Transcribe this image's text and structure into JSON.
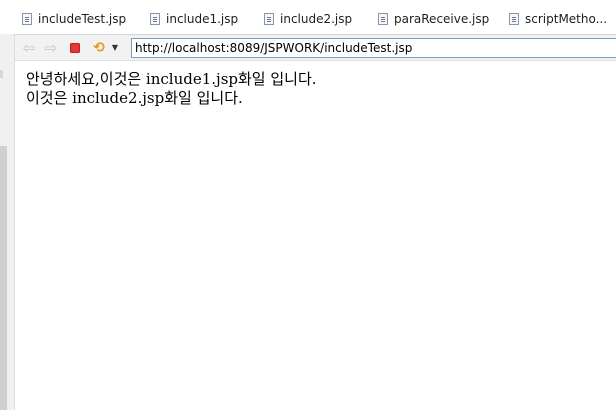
{
  "tabs": [
    {
      "label": "includeTest.jsp"
    },
    {
      "label": "include1.jsp"
    },
    {
      "label": "include2.jsp"
    },
    {
      "label": "paraReceive.jsp"
    },
    {
      "label": "scriptMetho..."
    }
  ],
  "toolbar": {
    "back_icon": "back-arrow-icon",
    "forward_icon": "forward-arrow-icon",
    "stop_icon": "stop-icon",
    "stop_color": "#e23a3a",
    "refresh_icon": "refresh-icon",
    "refresh_color": "#e39a1c",
    "url": "http://localhost:8089/JSPWORK/includeTest.jsp"
  },
  "page": {
    "line1": "안녕하세요,이것은 include1.jsp화일 입니다.",
    "line2": "이것은 include2.jsp화일 입니다."
  }
}
